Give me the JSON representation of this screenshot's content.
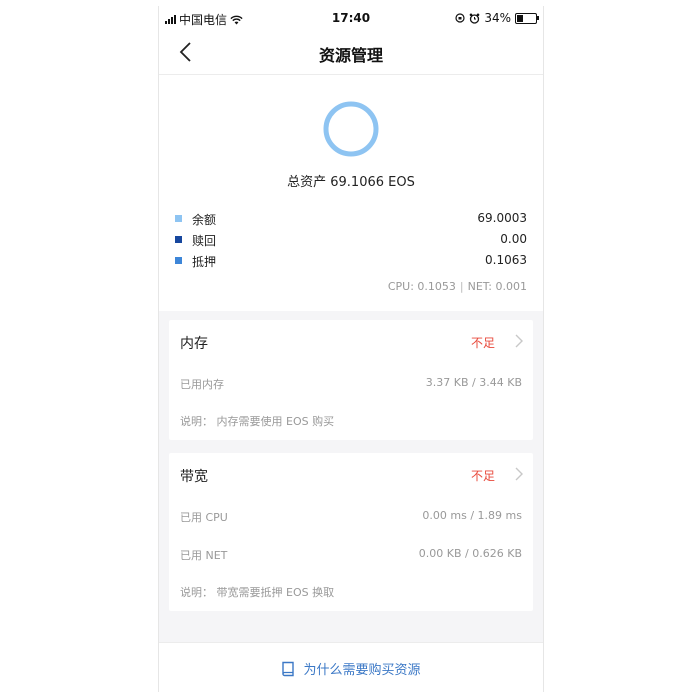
{
  "status_bar": {
    "carrier": "中国电信",
    "time": "17:40",
    "battery": "34%",
    "battery_level": 0.34
  },
  "nav": {
    "title": "资源管理"
  },
  "summary": {
    "total": "总资产 69.1066 EOS",
    "legend": [
      {
        "label": "余额",
        "value": "69.0003",
        "color": "#8ec4f2"
      },
      {
        "label": "赎回",
        "value": "0.00",
        "color": "#17479e"
      },
      {
        "label": "抵押",
        "value": "0.1063",
        "color": "#3d86d8"
      }
    ],
    "cpu": "CPU: 0.1053",
    "net": "NET: 0.001"
  },
  "memory": {
    "title": "内存",
    "status": "不足",
    "used_label": "已用内存",
    "used_value": "3.37 KB / 3.44 KB",
    "note": "说明： 内存需要使用 EOS 购买"
  },
  "bandwidth": {
    "title": "带宽",
    "status": "不足",
    "cpu_label": "已用 CPU",
    "cpu_value": "0.00 ms / 1.89 ms",
    "net_label": "已用 NET",
    "net_value": "0.00 KB / 0.626 KB",
    "note": "说明： 带宽需要抵押 EOS 换取"
  },
  "bottom": {
    "label": "为什么需要购买资源"
  },
  "colors": {
    "accent": "#3b78c6",
    "warning": "#e84a3c"
  }
}
